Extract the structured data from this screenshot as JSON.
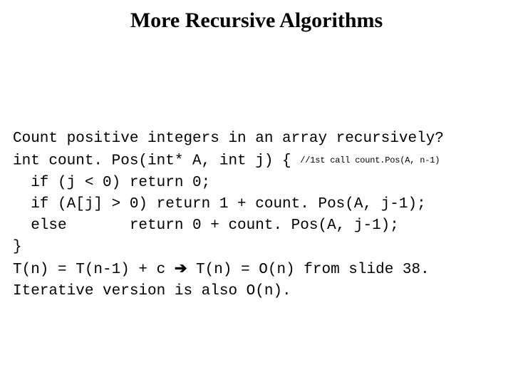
{
  "title": "More Recursive Algorithms",
  "code": {
    "l1": "Count positive integers in an array recursively?",
    "l2a": "int count. Pos(int* A, int j) { ",
    "l2b": "//1st call count.Pos(A, n-1)",
    "l3": "  if (j < 0) return 0;",
    "l4": "  if (A[j] > 0) return 1 + count. Pos(A, j-1);",
    "l5": "  else       return 0 + count. Pos(A, j-1);",
    "l6": "}",
    "l7a": "T(n) = T(n-1) + c ",
    "arrow": "➔",
    "l7b": " T(n) = O(n) from slide 38.",
    "l8": "Iterative version is also O(n)."
  }
}
